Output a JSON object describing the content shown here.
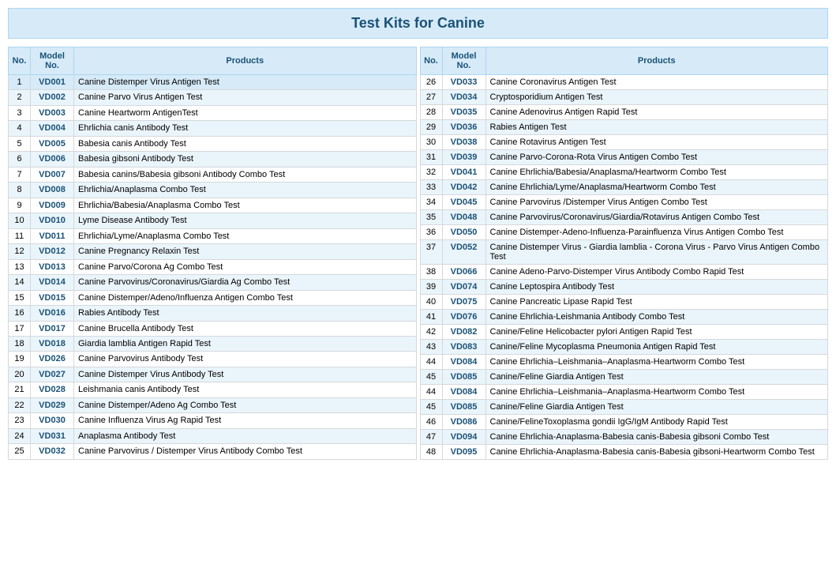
{
  "title": "Test Kits for Canine",
  "headers": {
    "no": "No.",
    "model": "Model No.",
    "products": "Products"
  },
  "left_rows": [
    {
      "no": 1,
      "model": "VD001",
      "product": "Canine Distemper Virus Antigen Test",
      "highlight": true
    },
    {
      "no": 2,
      "model": "VD002",
      "product": "Canine Parvo Virus Antigen Test"
    },
    {
      "no": 3,
      "model": "VD003",
      "product": "Canine Heartworm AntigenTest"
    },
    {
      "no": 4,
      "model": "VD004",
      "product": "Ehrlichia canis Antibody Test"
    },
    {
      "no": 5,
      "model": "VD005",
      "product": "Babesia canis Antibody Test"
    },
    {
      "no": 6,
      "model": "VD006",
      "product": "Babesia gibsoni Antibody Test"
    },
    {
      "no": 7,
      "model": "VD007",
      "product": "Babesia canins/Babesia gibsoni Antibody Combo Test"
    },
    {
      "no": 8,
      "model": "VD008",
      "product": "Ehrlichia/Anaplasma Combo Test"
    },
    {
      "no": 9,
      "model": "VD009",
      "product": "Ehrlichia/Babesia/Anaplasma Combo Test"
    },
    {
      "no": 10,
      "model": "VD010",
      "product": "Lyme Disease Antibody Test"
    },
    {
      "no": 11,
      "model": "VD011",
      "product": "Ehrlichia/Lyme/Anaplasma Combo Test"
    },
    {
      "no": 12,
      "model": "VD012",
      "product": "Canine Pregnancy Relaxin Test"
    },
    {
      "no": 13,
      "model": "VD013",
      "product": "Canine Parvo/Corona Ag Combo Test"
    },
    {
      "no": 14,
      "model": "VD014",
      "product": "Canine Parvovirus/Coronavirus/Giardia Ag Combo Test"
    },
    {
      "no": 15,
      "model": "VD015",
      "product": "Canine Distemper/Adeno/Influenza Antigen Combo Test"
    },
    {
      "no": 16,
      "model": "VD016",
      "product": "Rabies Antibody Test"
    },
    {
      "no": 17,
      "model": "VD017",
      "product": "Canine Brucella Antibody Test"
    },
    {
      "no": 18,
      "model": "VD018",
      "product": "Giardia lamblia Antigen Rapid Test"
    },
    {
      "no": 19,
      "model": "VD026",
      "product": "Canine Parvovirus Antibody Test"
    },
    {
      "no": 20,
      "model": "VD027",
      "product": "Canine Distemper Virus Antibody Test"
    },
    {
      "no": 21,
      "model": "VD028",
      "product": "Leishmania canis Antibody Test"
    },
    {
      "no": 22,
      "model": "VD029",
      "product": "Canine Distemper/Adeno Ag Combo Test"
    },
    {
      "no": 23,
      "model": "VD030",
      "product": "Canine Influenza Virus Ag Rapid Test"
    },
    {
      "no": 24,
      "model": "VD031",
      "product": "Anaplasma Antibody Test"
    },
    {
      "no": 25,
      "model": "VD032",
      "product": "Canine Parvovirus / Distemper Virus Antibody Combo Test"
    }
  ],
  "right_rows": [
    {
      "no": 26,
      "model": "VD033",
      "product": "Canine Coronavirus Antigen Test"
    },
    {
      "no": 27,
      "model": "VD034",
      "product": "Cryptosporidium Antigen Test"
    },
    {
      "no": 28,
      "model": "VD035",
      "product": "Canine Adenovirus Antigen Rapid Test"
    },
    {
      "no": 29,
      "model": "VD036",
      "product": "Rabies Antigen Test"
    },
    {
      "no": 30,
      "model": "VD038",
      "product": "Canine Rotavirus Antigen Test"
    },
    {
      "no": 31,
      "model": "VD039",
      "product": "Canine Parvo-Corona-Rota Virus Antigen Combo Test"
    },
    {
      "no": 32,
      "model": "VD041",
      "product": "Canine Ehrlichia/Babesia/Anaplasma/Heartworm Combo Test"
    },
    {
      "no": 33,
      "model": "VD042",
      "product": "Canine Ehrlichia/Lyme/Anaplasma/Heartworm Combo Test"
    },
    {
      "no": 34,
      "model": "VD045",
      "product": "Canine Parvovirus /Distemper Virus Antigen Combo Test"
    },
    {
      "no": 35,
      "model": "VD048",
      "product": "Canine Parvovirus/Coronavirus/Giardia/Rotavirus Antigen Combo Test"
    },
    {
      "no": 36,
      "model": "VD050",
      "product": "Canine Distemper-Adeno-Influenza-Parainfluenza Virus Antigen Combo Test"
    },
    {
      "no": 37,
      "model": "VD052",
      "product": "Canine Distemper Virus - Giardia lamblia - Corona Virus - Parvo Virus Antigen Combo Test"
    },
    {
      "no": 38,
      "model": "VD066",
      "product": "Canine Adeno-Parvo-Distemper Virus Antibody Combo Rapid Test"
    },
    {
      "no": 39,
      "model": "VD074",
      "product": "Canine Leptospira Antibody Test"
    },
    {
      "no": 40,
      "model": "VD075",
      "product": "Canine Pancreatic Lipase Rapid Test"
    },
    {
      "no": 41,
      "model": "VD076",
      "product": "Canine Ehrlichia-Leishmania Antibody Combo Test"
    },
    {
      "no": 42,
      "model": "VD082",
      "product": "Canine/Feline Helicobacter pylori Antigen Rapid Test"
    },
    {
      "no": 43,
      "model": "VD083",
      "product": "Canine/Feline  Mycoplasma Pneumonia Antigen Rapid Test"
    },
    {
      "no": 44,
      "model": "VD084",
      "product": "Canine Ehrlichia–Leishmania–Anaplasma-Heartworm Combo Test"
    },
    {
      "no": 45,
      "model": "VD085",
      "product": "Canine/Feline  Giardia Antigen Test"
    },
    {
      "no": 44,
      "model": "VD084",
      "product": "Canine Ehrlichia–Leishmania–Anaplasma-Heartworm Combo Test"
    },
    {
      "no": 45,
      "model": "VD085",
      "product": "Canine/Feline  Giardia Antigen Test"
    },
    {
      "no": 46,
      "model": "VD086",
      "product": "Canine/FelineToxoplasma gondii IgG/IgM Antibody Rapid Test"
    },
    {
      "no": 47,
      "model": "VD094",
      "product": "Canine Ehrlichia-Anaplasma-Babesia canis-Babesia gibsoni Combo Test"
    },
    {
      "no": 48,
      "model": "VD095",
      "product": "Canine Ehrlichia-Anaplasma-Babesia canis-Babesia gibsoni-Heartworm Combo Test"
    }
  ]
}
